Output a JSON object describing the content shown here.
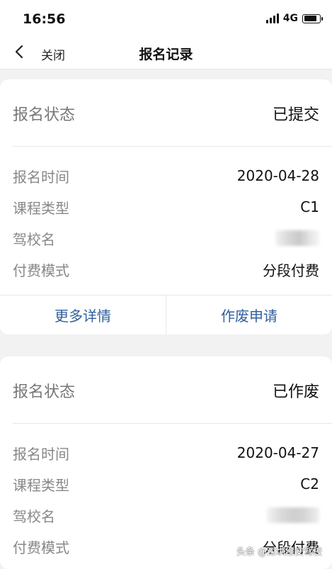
{
  "statusbar": {
    "time": "16:56",
    "network": "4G",
    "battery_level": 0.82
  },
  "navbar": {
    "close_label": "关闭",
    "title": "报名记录"
  },
  "records": [
    {
      "status_label": "报名状态",
      "status_value": "已提交",
      "rows": [
        {
          "label": "报名时间",
          "value": "2020-04-28"
        },
        {
          "label": "课程类型",
          "value": "C1"
        },
        {
          "label": "驾校名",
          "value": ""
        },
        {
          "label": "付费模式",
          "value": "分段付费"
        }
      ],
      "actions": {
        "details": "更多详情",
        "cancel": "作废申请"
      }
    },
    {
      "status_label": "报名状态",
      "status_value": "已作废",
      "rows": [
        {
          "label": "报名时间",
          "value": "2020-04-27"
        },
        {
          "label": "课程类型",
          "value": "C2"
        },
        {
          "label": "驾校名",
          "value": ""
        },
        {
          "label": "付费模式",
          "value": "分段付费"
        }
      ]
    }
  ],
  "watermark": "头条 @深圳综安驾校",
  "icons": {
    "back": "chevron-left-icon"
  }
}
